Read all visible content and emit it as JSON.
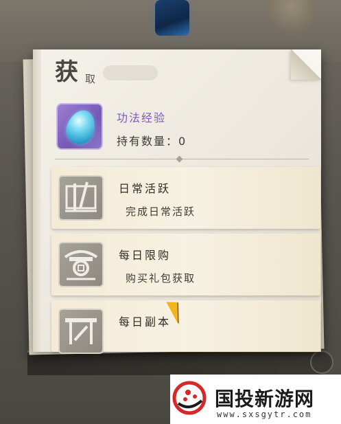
{
  "panel": {
    "title": "获",
    "title_sub": "取"
  },
  "item": {
    "name": "功法经验",
    "count_label": "持有数量：",
    "count_value": "0",
    "icon": "droplet-gem-icon",
    "icon_color": "#7457b4"
  },
  "sources": [
    {
      "title": "日常活跃",
      "desc": "完成日常活跃",
      "icon": "scroll-brush-icon"
    },
    {
      "title": "每日限购",
      "desc": "购买礼包获取",
      "icon": "shop-pavilion-icon"
    },
    {
      "title": "每日副本",
      "desc": "",
      "icon": "dungeon-gate-icon"
    }
  ],
  "watermark": {
    "brand": "国投新游网",
    "url": "www.sxsgytr.com"
  },
  "colors": {
    "item_name": "#7f58b8",
    "cursor": "#f2b51d"
  }
}
